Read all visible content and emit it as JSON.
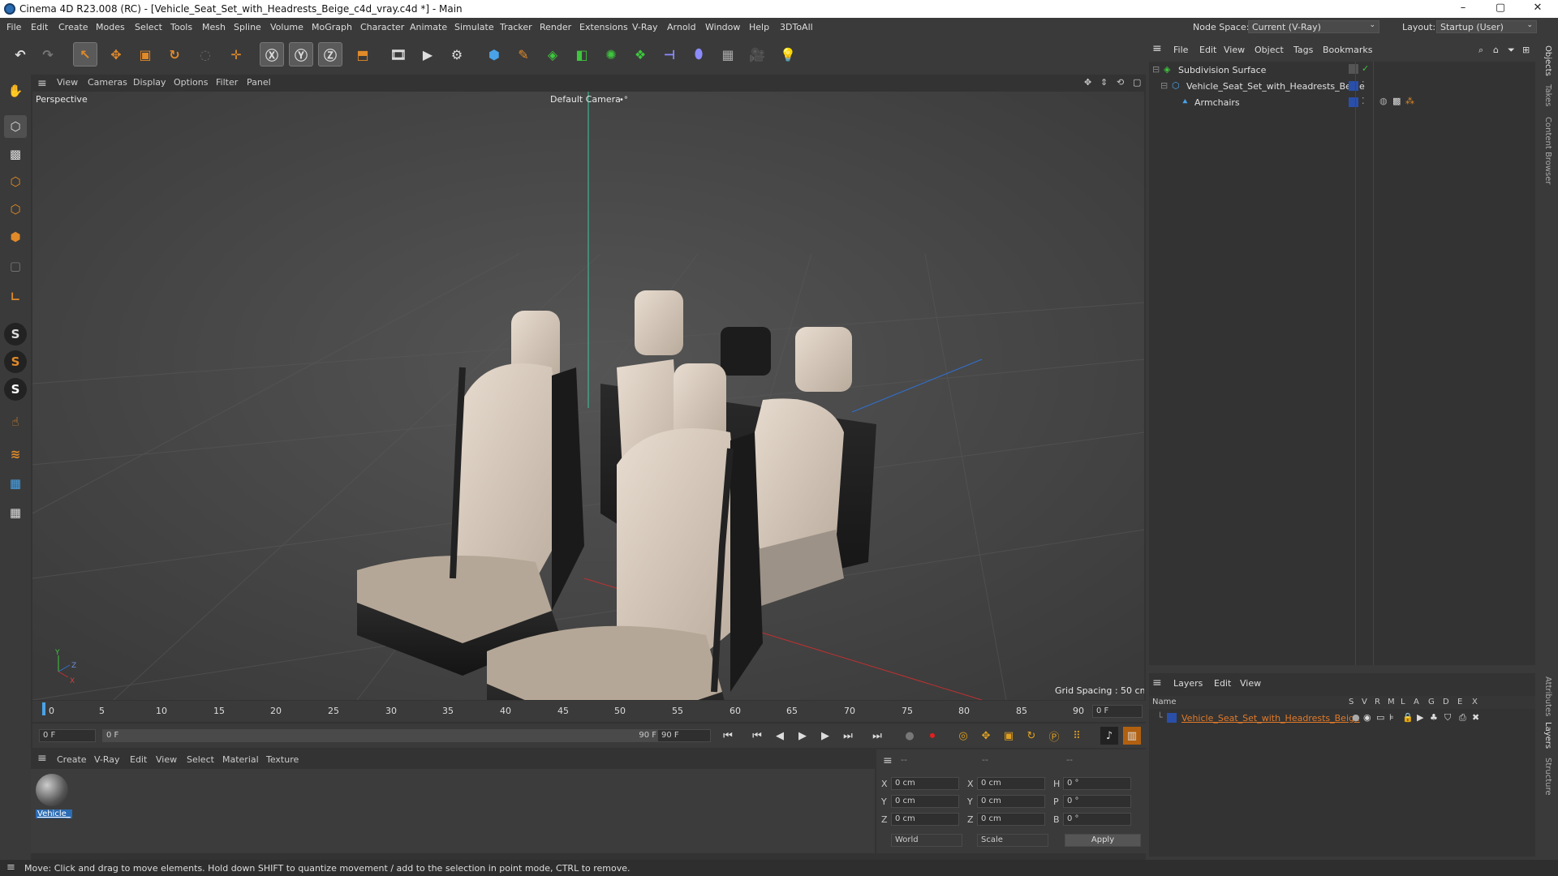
{
  "titlebar": {
    "title": "Cinema 4D R23.008 (RC) - [Vehicle_Seat_Set_with_Headrests_Beige_c4d_vray.c4d *] - Main",
    "minimize": "–",
    "maximize": "▢",
    "close": "✕"
  },
  "menubar": {
    "items": [
      "File",
      "Edit",
      "Create",
      "Modes",
      "Select",
      "Tools",
      "Mesh",
      "Spline",
      "Volume",
      "MoGraph",
      "Character",
      "Animate",
      "Simulate",
      "Tracker",
      "Render",
      "Extensions",
      "V-Ray",
      "Arnold",
      "Window",
      "Help",
      "3DToAll"
    ],
    "node_space_label": "Node Space:",
    "node_space_value": "Current (V-Ray)",
    "layout_label": "Layout:",
    "layout_value": "Startup (User)"
  },
  "viewport_menu": {
    "items": [
      "View",
      "Cameras",
      "Display",
      "Options",
      "Filter",
      "Panel"
    ]
  },
  "viewport": {
    "view_name": "Perspective",
    "camera": "Default Camera",
    "camera_icon": "•°",
    "grid_spacing": "Grid Spacing : 50 cm",
    "axis_y": "Y",
    "axis_z": "Z",
    "axis_x": "X"
  },
  "timeline": {
    "ticks": [
      "0",
      "5",
      "10",
      "15",
      "20",
      "25",
      "30",
      "35",
      "40",
      "45",
      "50",
      "55",
      "60",
      "65",
      "70",
      "75",
      "80",
      "85",
      "90"
    ],
    "current_frame": "0 F"
  },
  "tl_controls": {
    "start": "0 F",
    "range_start": "0 F",
    "range_end": "90 F",
    "end": "90 F"
  },
  "material_menu": {
    "items": [
      "Create",
      "V-Ray",
      "Edit",
      "View",
      "Select",
      "Material",
      "Texture"
    ]
  },
  "materials": [
    {
      "name": "Vehicle_"
    }
  ],
  "coords": {
    "header_dashes": [
      "--",
      "--",
      "--"
    ],
    "rows": [
      {
        "a": "X",
        "av": "0 cm",
        "b": "X",
        "bv": "0 cm",
        "c": "H",
        "cv": "0 °"
      },
      {
        "a": "Y",
        "av": "0 cm",
        "b": "Y",
        "bv": "0 cm",
        "c": "P",
        "cv": "0 °"
      },
      {
        "a": "Z",
        "av": "0 cm",
        "b": "Z",
        "bv": "0 cm",
        "c": "B",
        "cv": "0 °"
      }
    ],
    "world": "World",
    "scale": "Scale",
    "apply": "Apply"
  },
  "status": {
    "text": "Move: Click and drag to move elements. Hold down SHIFT to quantize movement / add to the selection in point mode, CTRL to remove."
  },
  "object_manager": {
    "menu": [
      "File",
      "Edit",
      "View",
      "Object",
      "Tags",
      "Bookmarks"
    ],
    "objects": [
      {
        "name": "Subdivision Surface"
      },
      {
        "name": "Vehicle_Seat_Set_with_Headrests_Beige"
      },
      {
        "name": "Armchairs"
      }
    ]
  },
  "layer_manager": {
    "menu": [
      "Layers",
      "Edit",
      "View"
    ],
    "columns": [
      "Name",
      "S",
      "V",
      "R",
      "M",
      "L",
      "A",
      "G",
      "D",
      "E",
      "X"
    ],
    "layers": [
      {
        "name": "Vehicle_Seat_Set_with_Headrests_Beige",
        "color": "#e07a2a"
      }
    ]
  },
  "side_tabs": [
    "Objects",
    "Takes",
    "Content Browser",
    "Attributes",
    "Layers",
    "Structure"
  ],
  "colors": {
    "accent": "#2b6cb3",
    "orange": "#e07a2a",
    "green": "#3ec63e"
  }
}
